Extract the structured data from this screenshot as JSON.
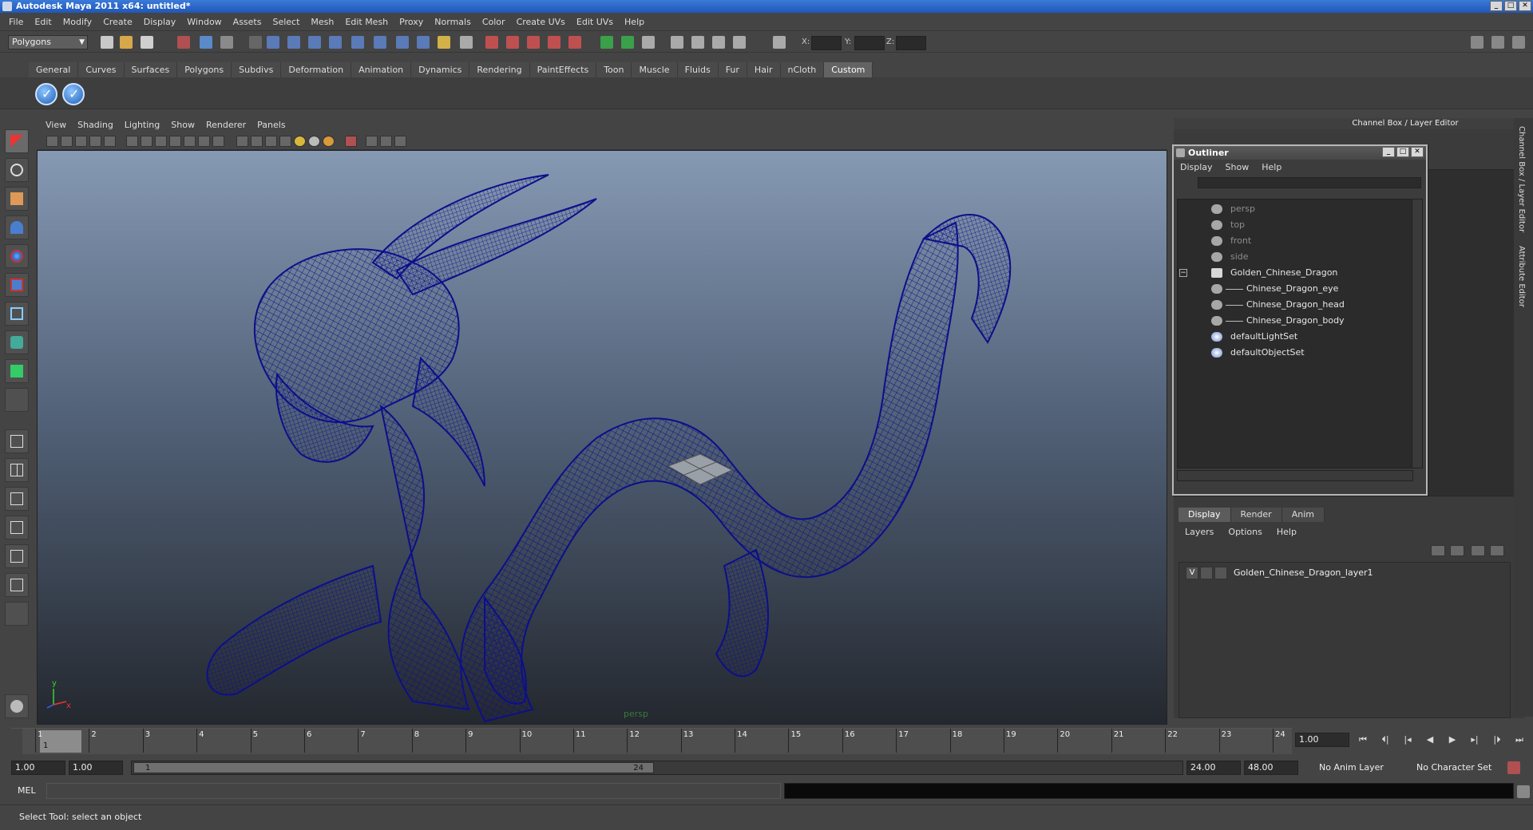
{
  "window": {
    "title": "Autodesk Maya 2011 x64: untitled*",
    "controls": [
      "_",
      "□",
      "✕"
    ]
  },
  "menubar": [
    "File",
    "Edit",
    "Modify",
    "Create",
    "Display",
    "Window",
    "Assets",
    "Select",
    "Mesh",
    "Edit Mesh",
    "Proxy",
    "Normals",
    "Color",
    "Create UVs",
    "Edit UVs",
    "Help"
  ],
  "statusline": {
    "mode": "Polygons",
    "coord_labels": [
      "X:",
      "Y:",
      "Z:"
    ]
  },
  "shelf": {
    "tabs": [
      "General",
      "Curves",
      "Surfaces",
      "Polygons",
      "Subdivs",
      "Deformation",
      "Animation",
      "Dynamics",
      "Rendering",
      "PaintEffects",
      "Toon",
      "Muscle",
      "Fluids",
      "Fur",
      "Hair",
      "nCloth",
      "Custom"
    ],
    "active_tab": "Custom",
    "button_glyph": "✓"
  },
  "viewport": {
    "menu": [
      "View",
      "Shading",
      "Lighting",
      "Show",
      "Renderer",
      "Panels"
    ],
    "camera_label": "persp",
    "axis_y": "y",
    "axis_x": "x",
    "wire_color": "#0c0f8a"
  },
  "channel_box": {
    "header": "Channel Box / Layer Editor",
    "side_tabs": [
      "Channel Box / Layer Editor",
      "Attribute Editor"
    ]
  },
  "outliner": {
    "title": "Outliner",
    "menu": [
      "Display",
      "Show",
      "Help"
    ],
    "items": [
      {
        "label": "persp",
        "dim": true,
        "indent": 0
      },
      {
        "label": "top",
        "dim": true,
        "indent": 0
      },
      {
        "label": "front",
        "dim": true,
        "indent": 0
      },
      {
        "label": "side",
        "dim": true,
        "indent": 0
      },
      {
        "label": "Golden_Chinese_Dragon",
        "dim": false,
        "indent": 0
      },
      {
        "label": "Chinese_Dragon_eye",
        "dim": false,
        "indent": 1
      },
      {
        "label": "Chinese_Dragon_head",
        "dim": false,
        "indent": 1
      },
      {
        "label": "Chinese_Dragon_body",
        "dim": false,
        "indent": 1
      },
      {
        "label": "defaultLightSet",
        "dim": false,
        "indent": 0
      },
      {
        "label": "defaultObjectSet",
        "dim": false,
        "indent": 0
      }
    ]
  },
  "layer_editor": {
    "tabs": [
      "Display",
      "Render",
      "Anim"
    ],
    "active_tab": "Display",
    "menu": [
      "Layers",
      "Options",
      "Help"
    ],
    "layer": {
      "visible": "V",
      "name": "Golden_Chinese_Dragon_layer1"
    }
  },
  "timeline": {
    "ticks": [
      "1",
      "2",
      "3",
      "4",
      "5",
      "6",
      "7",
      "8",
      "9",
      "10",
      "11",
      "12",
      "13",
      "14",
      "15",
      "16",
      "17",
      "18",
      "19",
      "20",
      "21",
      "22",
      "23",
      "24"
    ],
    "current_frame": "1",
    "current_time": "1.00",
    "playback": [
      "⏮",
      "⏴|",
      "|◂",
      "◀",
      "▶",
      "▸|",
      "|⏵",
      "⏭"
    ]
  },
  "range": {
    "start": "1.00",
    "playback_start": "1.00",
    "slider_start": "1",
    "slider_end": "24",
    "playback_end": "24.00",
    "end": "48.00",
    "anim_layer": "No Anim Layer",
    "character_set": "No Character Set"
  },
  "command": {
    "label": "MEL"
  },
  "help_line": "Select Tool: select an object"
}
